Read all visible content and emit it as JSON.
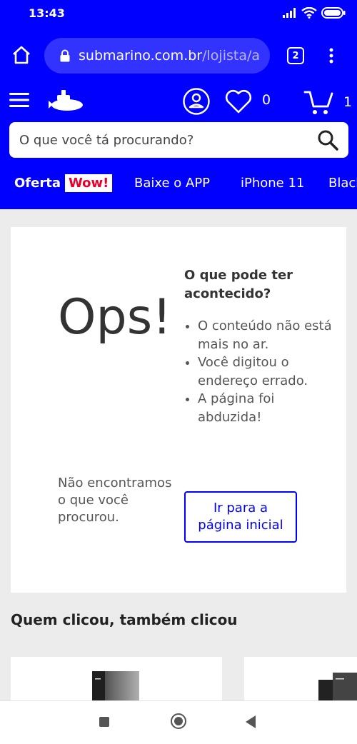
{
  "status_bar": {
    "time": "13:43"
  },
  "browser": {
    "url_domain": "submarino.com.br",
    "url_path": "/lojista/a",
    "tab_count": "2"
  },
  "header": {
    "favorites_count": "0",
    "cart_count": "1"
  },
  "search": {
    "placeholder": "O que você tá procurando?"
  },
  "categories": {
    "offer_label": "Oferta",
    "wow_label": "Wow!",
    "items": [
      "Baixe o APP",
      "iPhone 11",
      "Black"
    ]
  },
  "error": {
    "title": "Ops!",
    "message": "Não encontramos o que você procurou.",
    "causes_title": "O que pode ter acontecido?",
    "causes": [
      "O conteúdo não está mais no ar.",
      "Você digitou o endereço errado.",
      "A página foi abduzida!"
    ],
    "home_button": "Ir para a página inicial"
  },
  "recommendations": {
    "heading": "Quem clicou, também clicou"
  },
  "colors": {
    "brand_blue": "#0000ff",
    "wow_red": "#e8002d",
    "background": "#ececec"
  },
  "icons": {
    "browser_home": "home-icon",
    "lock": "lock-icon",
    "menu": "hamburger-icon",
    "logo": "submarine-logo",
    "account": "user-icon",
    "favorites": "heart-icon",
    "cart": "cart-icon",
    "search": "search-icon"
  }
}
